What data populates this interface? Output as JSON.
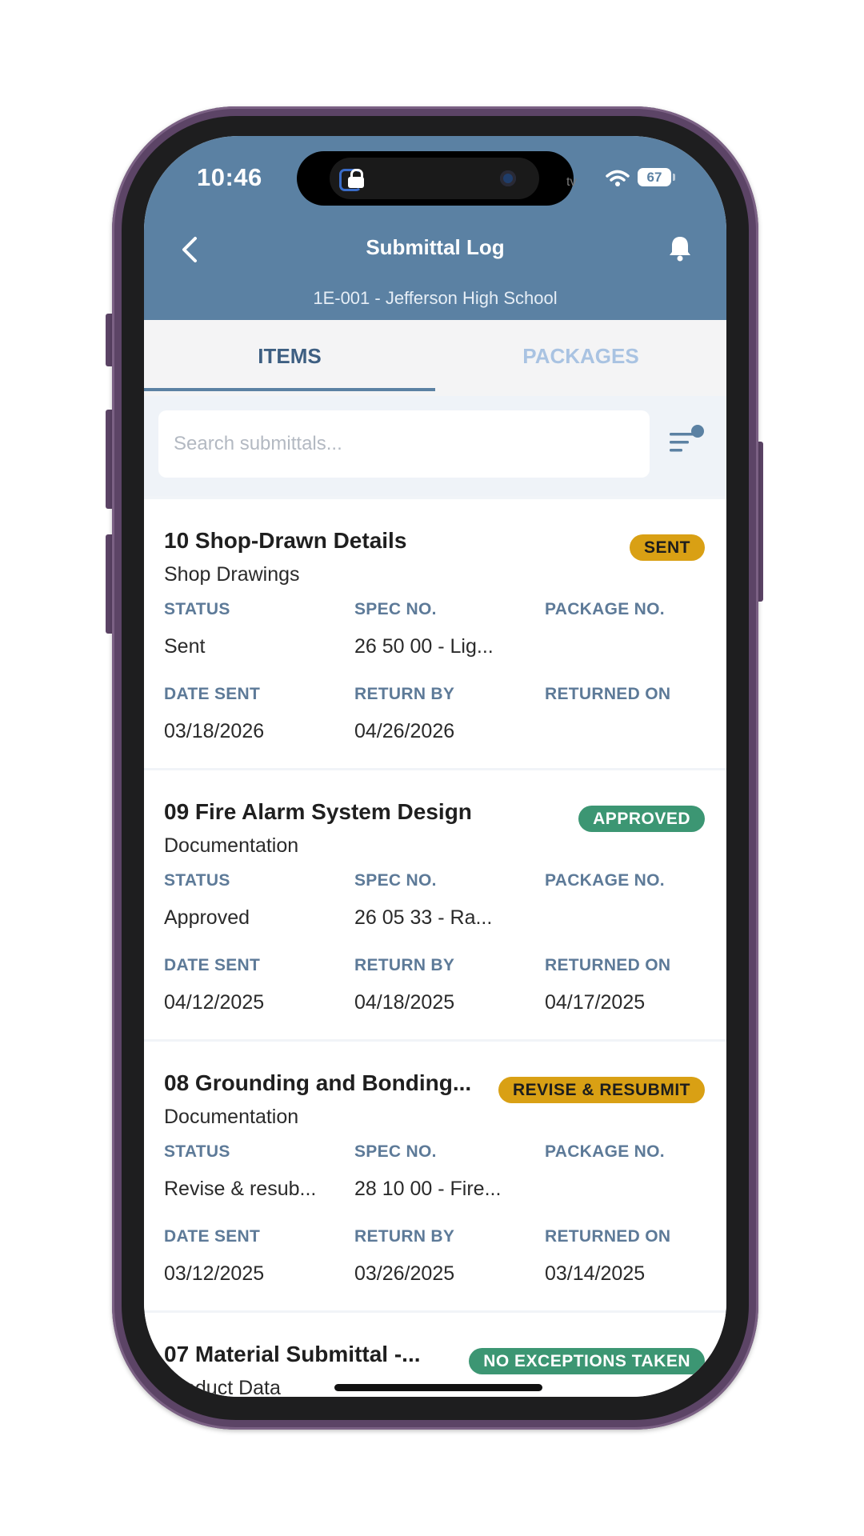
{
  "status_bar": {
    "time": "10:46",
    "battery": "67",
    "island_text": "tv"
  },
  "header": {
    "title": "Submittal Log",
    "subtitle": "1E-001 - Jefferson High School"
  },
  "tabs": [
    {
      "label": "ITEMS",
      "active": true
    },
    {
      "label": "PACKAGES",
      "active": false
    }
  ],
  "search": {
    "placeholder": "Search submittals...",
    "value": ""
  },
  "labels": {
    "status": "STATUS",
    "spec_no": "SPEC NO.",
    "package_no": "PACKAGE NO.",
    "date_sent": "DATE SENT",
    "return_by": "RETURN BY",
    "returned_on": "RETURNED ON"
  },
  "colors": {
    "header": "#5b81a3",
    "badge_yellow": "#d9a014",
    "badge_green": "#3c9673"
  },
  "submittals": [
    {
      "title": "10 Shop-Drawn Details",
      "type": "Shop Drawings",
      "badge": "SENT",
      "status": "Sent",
      "spec_no": "26 50 00 - Lig...",
      "package_no": "",
      "date_sent": "03/18/2026",
      "return_by": "04/26/2026",
      "returned_on": ""
    },
    {
      "title": "09 Fire Alarm System Design",
      "type": "Documentation",
      "badge": "APPROVED",
      "status": "Approved",
      "spec_no": "26 05 33 - Ra...",
      "package_no": "",
      "date_sent": "04/12/2025",
      "return_by": "04/18/2025",
      "returned_on": "04/17/2025"
    },
    {
      "title": "08 Grounding and Bonding...",
      "type": "Documentation",
      "badge": "REVISE & RESUBMIT",
      "status": "Revise & resub...",
      "spec_no": "28 10 00 - Fire...",
      "package_no": "",
      "date_sent": "03/12/2025",
      "return_by": "03/26/2025",
      "returned_on": "03/14/2025"
    },
    {
      "title": "07 Material Submittal -...",
      "type": "Product Data",
      "badge": "NO EXCEPTIONS TAKEN"
    }
  ]
}
